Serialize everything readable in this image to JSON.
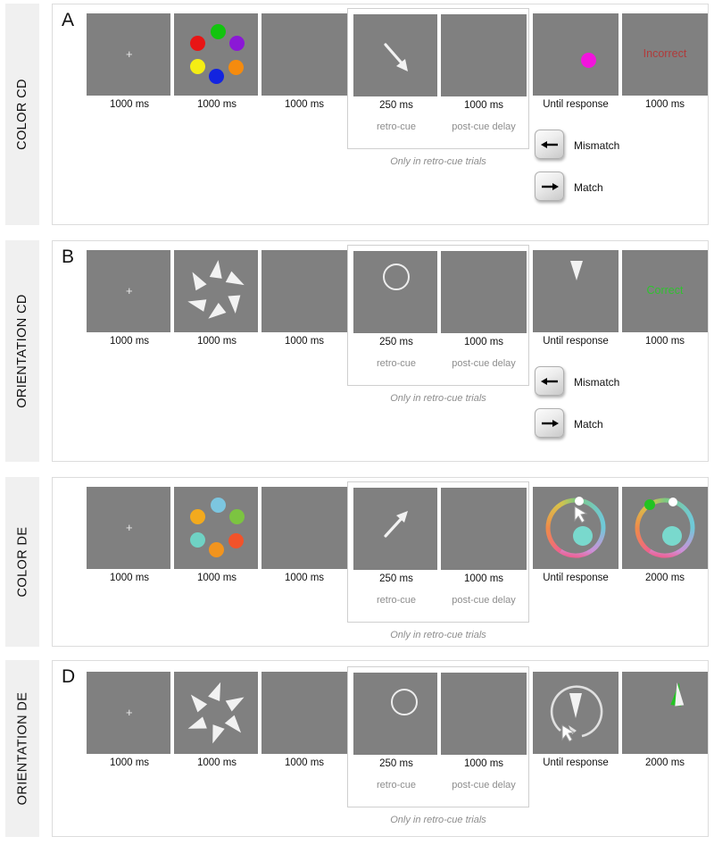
{
  "figure": {
    "rows": [
      {
        "id": "color-cd",
        "side_label": "COLOR CD",
        "letter": "A",
        "task_type": "change-detection",
        "stimulus_kind": "colored-dots",
        "screens": [
          {
            "name": "fixation",
            "duration": "1000 ms"
          },
          {
            "name": "memory-array",
            "duration": "1000 ms"
          },
          {
            "name": "retention",
            "duration": "1000 ms"
          },
          {
            "name": "retro-cue",
            "duration": "250 ms",
            "sub": "retro-cue"
          },
          {
            "name": "post-cue-delay",
            "duration": "1000 ms",
            "sub": "post-cue delay"
          },
          {
            "name": "probe",
            "duration": "Until response"
          },
          {
            "name": "feedback",
            "duration": "1000 ms"
          }
        ],
        "cue_note": "Only in retro-cue trials",
        "cue_icon": "arrow-down-right",
        "feedback_text": "Incorrect",
        "feedback_color": "#b03a3a",
        "probe_dot_color": "#f214dd",
        "keys": [
          {
            "icon": "arrow-left-key",
            "label": "Mismatch"
          },
          {
            "icon": "arrow-right-key",
            "label": "Match"
          }
        ],
        "stimulus_colors": [
          "#12c40f",
          "#8b18d6",
          "#f58b0e",
          "#1324e0",
          "#f4ed14",
          "#e81515"
        ]
      },
      {
        "id": "orientation-cd",
        "side_label": "ORIENTATION CD",
        "letter": "B",
        "task_type": "change-detection",
        "stimulus_kind": "oriented-triangles",
        "screens": [
          {
            "name": "fixation",
            "duration": "1000 ms"
          },
          {
            "name": "memory-array",
            "duration": "1000 ms"
          },
          {
            "name": "retention",
            "duration": "1000 ms"
          },
          {
            "name": "retro-cue",
            "duration": "250 ms",
            "sub": "retro-cue"
          },
          {
            "name": "post-cue-delay",
            "duration": "1000 ms",
            "sub": "post-cue delay"
          },
          {
            "name": "probe",
            "duration": "Until response"
          },
          {
            "name": "feedback",
            "duration": "1000 ms"
          }
        ],
        "cue_note": "Only in retro-cue trials",
        "cue_icon": "circle-outline",
        "feedback_text": "Correct",
        "feedback_color": "#2fc22f",
        "keys": [
          {
            "icon": "arrow-left-key",
            "label": "Mismatch"
          },
          {
            "icon": "arrow-right-key",
            "label": "Match"
          }
        ],
        "stimulus_angles": [
          8,
          118,
          176,
          232,
          283,
          330
        ]
      },
      {
        "id": "color-de",
        "side_label": "COLOR DE",
        "letter": "",
        "task_type": "delayed-estimation",
        "stimulus_kind": "colored-dots",
        "screens": [
          {
            "name": "fixation",
            "duration": "1000 ms"
          },
          {
            "name": "memory-array",
            "duration": "1000 ms"
          },
          {
            "name": "retention",
            "duration": "1000 ms"
          },
          {
            "name": "retro-cue",
            "duration": "250 ms",
            "sub": "retro-cue"
          },
          {
            "name": "post-cue-delay",
            "duration": "1000 ms",
            "sub": "post-cue delay"
          },
          {
            "name": "response-wheel",
            "duration": "Until response"
          },
          {
            "name": "feedback",
            "duration": "2000 ms"
          }
        ],
        "cue_note": "Only in retro-cue trials",
        "cue_icon": "arrow-up-right",
        "center_patch_color": "#79d9cd",
        "feedback_marker_color": "#22c322",
        "stimulus_colors": [
          "#7cc6e0",
          "#f2aa1e",
          "#7cc441",
          "#6fd2c4",
          "#f2532a",
          "#f2941e"
        ]
      },
      {
        "id": "orientation-de",
        "side_label": "ORIENTATION DE",
        "letter": "D",
        "task_type": "delayed-estimation",
        "stimulus_kind": "oriented-triangles",
        "screens": [
          {
            "name": "fixation",
            "duration": "1000 ms"
          },
          {
            "name": "memory-array",
            "duration": "1000 ms"
          },
          {
            "name": "retention",
            "duration": "1000 ms"
          },
          {
            "name": "retro-cue",
            "duration": "250 ms",
            "sub": "retro-cue"
          },
          {
            "name": "post-cue-delay",
            "duration": "1000 ms",
            "sub": "post-cue delay"
          },
          {
            "name": "response-dial",
            "duration": "Until response"
          },
          {
            "name": "feedback",
            "duration": "2000 ms"
          }
        ],
        "cue_note": "Only in retro-cue trials",
        "cue_icon": "circle-outline",
        "feedback_marker_color": "#22c322",
        "stimulus_angles": [
          22,
          60,
          140,
          200,
          250,
          320
        ]
      }
    ],
    "palette": {
      "screen_gray": "#808080",
      "page_background": "#ffffff",
      "side_label_background": "#f0f0f0",
      "panel_border": "#dcdcdc",
      "cue_group_border": "#cfcfcf",
      "muted_text": "#8d8d8d",
      "primary_text": "#111111"
    }
  }
}
